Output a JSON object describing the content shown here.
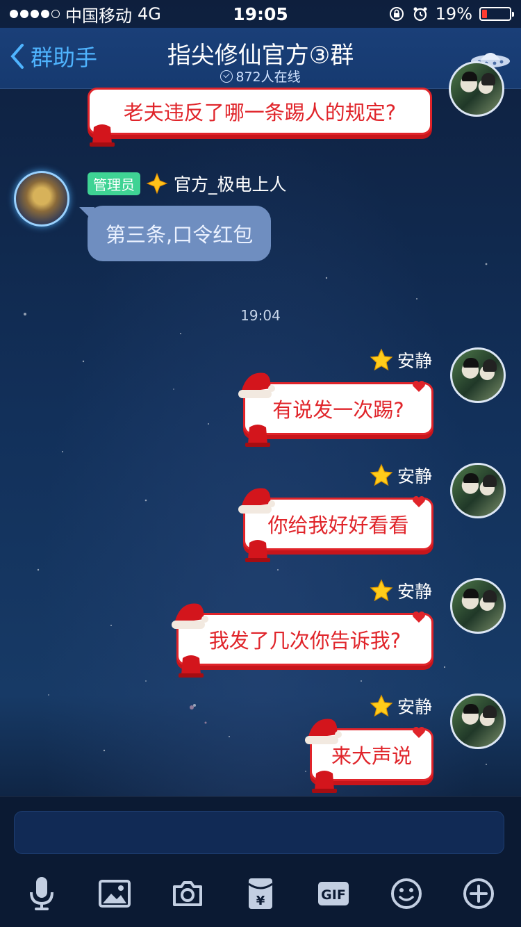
{
  "status_bar": {
    "carrier": "中国移动",
    "network": "4G",
    "time": "19:05",
    "battery": "19%",
    "battery_level": 0.19
  },
  "nav": {
    "back_label": "群助手",
    "title": "指尖修仙官方③群",
    "subtitle": "872人在线"
  },
  "messages": {
    "top_partial_text": "老夫违反了哪一条踢人的规定?",
    "admin_badge": "管理员",
    "admin_name": "官方_极电上人",
    "admin_text": "第三条,口令红包",
    "time_label": "19:04",
    "self_name": "安静",
    "self_msgs": [
      "有说发一次踢?",
      "你给我好好看看",
      "我发了几次你告诉我?",
      "来大声说"
    ]
  }
}
